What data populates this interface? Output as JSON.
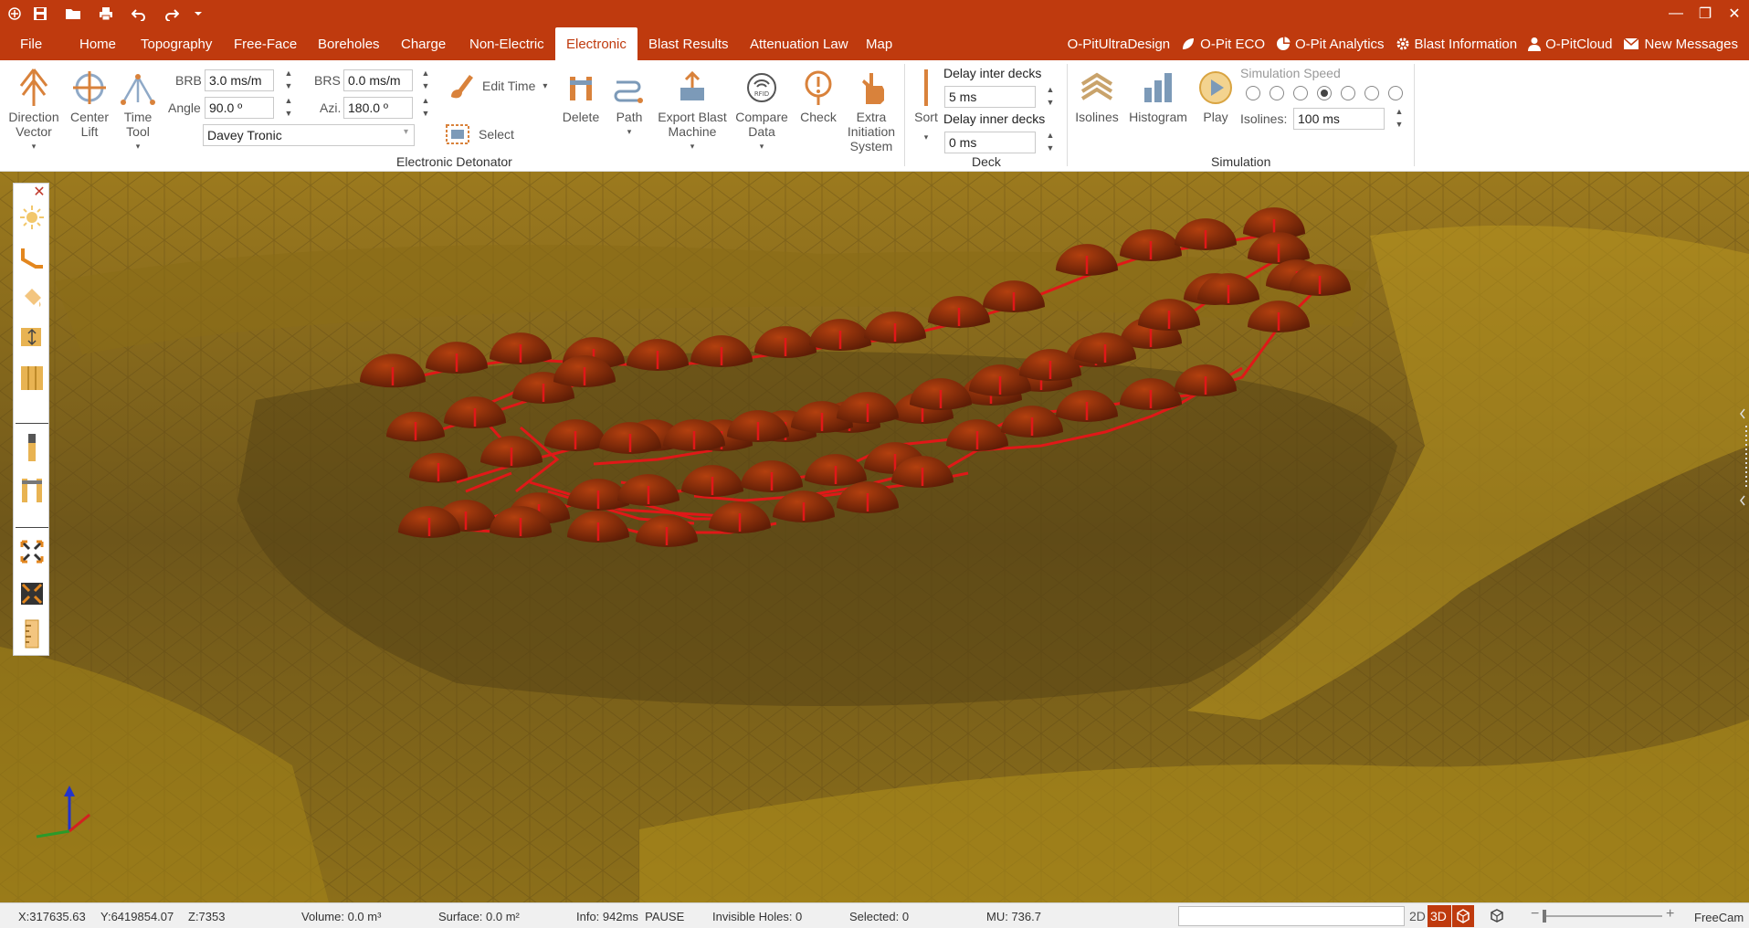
{
  "colors": {
    "accent": "#bf3a0e",
    "terrain": "#8a6d1a",
    "hole": "#8a2a0a",
    "tie_line": "#e01818"
  },
  "titlebar": {
    "minimize": "—",
    "restore": "❐",
    "close": "✕"
  },
  "menu": {
    "tabs": [
      "File",
      "Home",
      "Topography",
      "Free-Face",
      "Boreholes",
      "Charge",
      "Non-Electric",
      "Electronic",
      "Blast Results",
      "Attenuation Law",
      "Map"
    ],
    "active": "Electronic",
    "right_links": [
      "O-PitUltraDesign",
      "O-Pit ECO",
      "O-Pit Analytics",
      "Blast Information",
      "O-PitCloud",
      "New Messages"
    ]
  },
  "ribbon": {
    "direction_vector": "Direction\nVector",
    "center_lift": "Center\nLift",
    "time_tool": "Time\nTool",
    "brb_label": "BRB",
    "brb_value": "3.0 ms/m",
    "brs_label": "BRS",
    "brs_value": "0.0 ms/m",
    "angle_label": "Angle",
    "angle_value": "90.0 º",
    "azi_label": "Azi.",
    "azi_value": "180.0 º",
    "detonator_select": "Davey Tronic",
    "edit_time": "Edit Time",
    "select": "Select",
    "delete": "Delete",
    "path": "Path",
    "export_blast_machine": "Export Blast\nMachine",
    "compare_data": "Compare\nData",
    "check": "Check",
    "extra_initiation": "Extra\nInitiation\nSystem",
    "group_electronic": "Electronic Detonator",
    "sort": "Sort",
    "delay_inter_decks_label": "Delay inter decks",
    "delay_inter_decks_value": "5 ms",
    "delay_inner_decks_label": "Delay inner decks",
    "delay_inner_decks_value": "0 ms",
    "group_deck": "Deck",
    "isolines": "Isolines",
    "histogram": "Histogram",
    "play": "Play",
    "simulation_speed_label": "Simulation Speed",
    "simulation_speed_selected": 4,
    "isolines_label": "Isolines:",
    "isolines_value": "100 ms",
    "group_simulation": "Simulation"
  },
  "statusbar": {
    "x": "X:317635.63",
    "y": "Y:6419854.07",
    "z": "Z:7353",
    "volume": "Volume: 0.0 m³",
    "surface": "Surface: 0.0 m²",
    "info": "Info: 942ms  PAUSE",
    "invisible_holes": "Invisible Holes: 0",
    "selected": "Selected: 0",
    "mu": "MU: 736.7",
    "view_2d": "2D",
    "view_3d": "3D",
    "camera": "FreeCam"
  }
}
